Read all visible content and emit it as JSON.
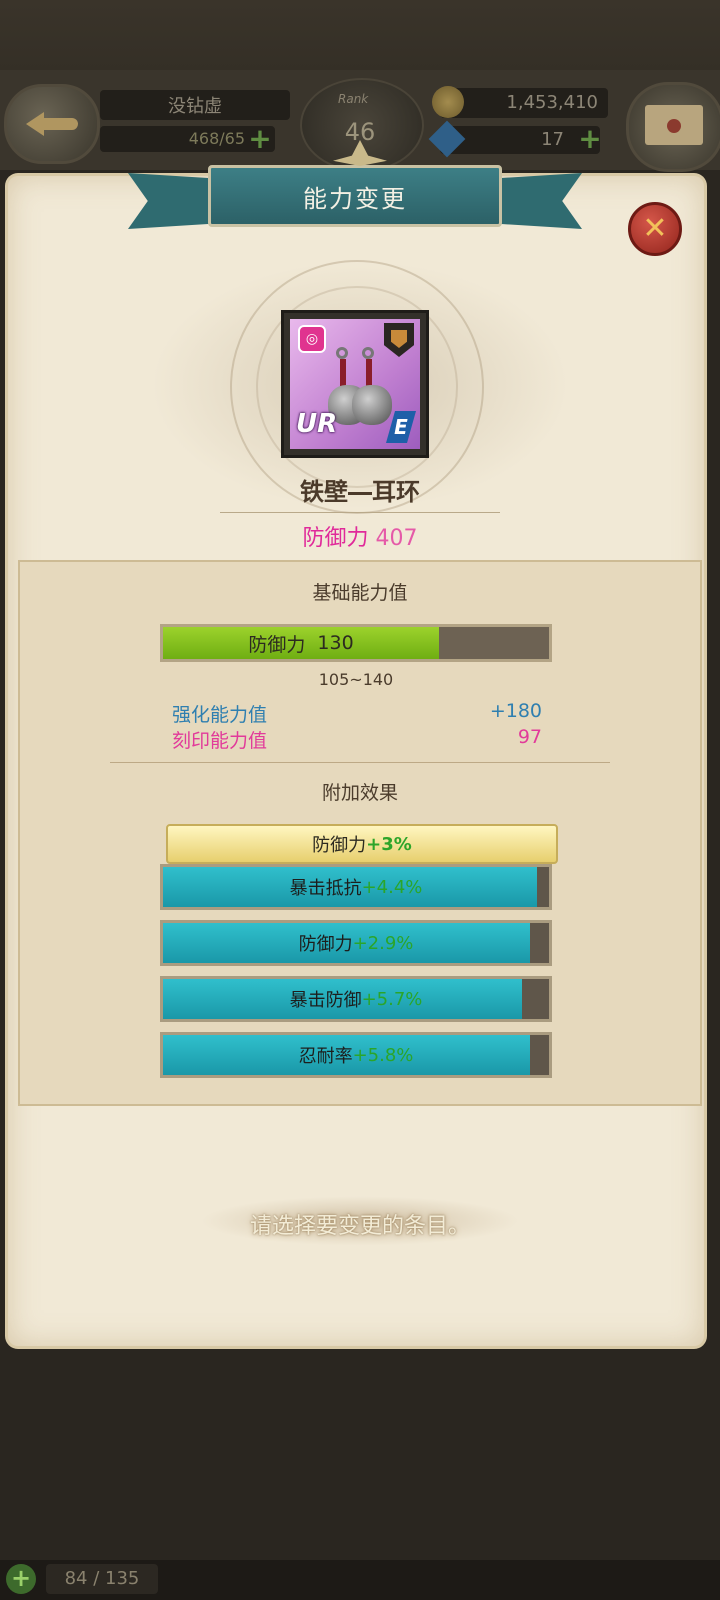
{
  "hud": {
    "player_name": "没钻虚",
    "stamina": "468/65",
    "rank_label": "Rank",
    "rank": "46",
    "gold": "1,453,410",
    "gems": "17"
  },
  "dialog": {
    "title": "能力变更",
    "close_symbol": "✕"
  },
  "item": {
    "name": "铁壁―耳环",
    "rarity": "UR",
    "grade": "E",
    "stat_label": "防御力",
    "stat_value": "407"
  },
  "base_stats": {
    "title": "基础能力值",
    "bar_label": "防御力",
    "bar_value": "130",
    "bar_fraction": 0.714,
    "range": "105~140",
    "enhance_label": "强化能力值",
    "enhance_value": "+180",
    "engrave_label": "刻印能力值",
    "engrave_value": "97"
  },
  "extra_effects": {
    "title": "附加效果",
    "set_bonus": {
      "label": "防御力",
      "value": "+3%"
    },
    "options": [
      {
        "label": "暴击抵抗",
        "value": "+4.4%",
        "fraction": 0.97
      },
      {
        "label": "防御力",
        "value": "+2.9%",
        "fraction": 0.95
      },
      {
        "label": "暴击防御",
        "value": "+5.7%",
        "fraction": 0.93
      },
      {
        "label": "忍耐率",
        "value": "+5.8%",
        "fraction": 0.95
      }
    ]
  },
  "hint": "请选择要变更的条目。",
  "bottom": {
    "plus_symbol": "+",
    "count": "84 / 135"
  },
  "colors": {
    "banner": "#2f6b70",
    "bar_green": "#8cc820",
    "option_cyan": "#22b0bf",
    "stat_pink": "#e02a9a",
    "enhance_blue": "#2f7fb0"
  }
}
